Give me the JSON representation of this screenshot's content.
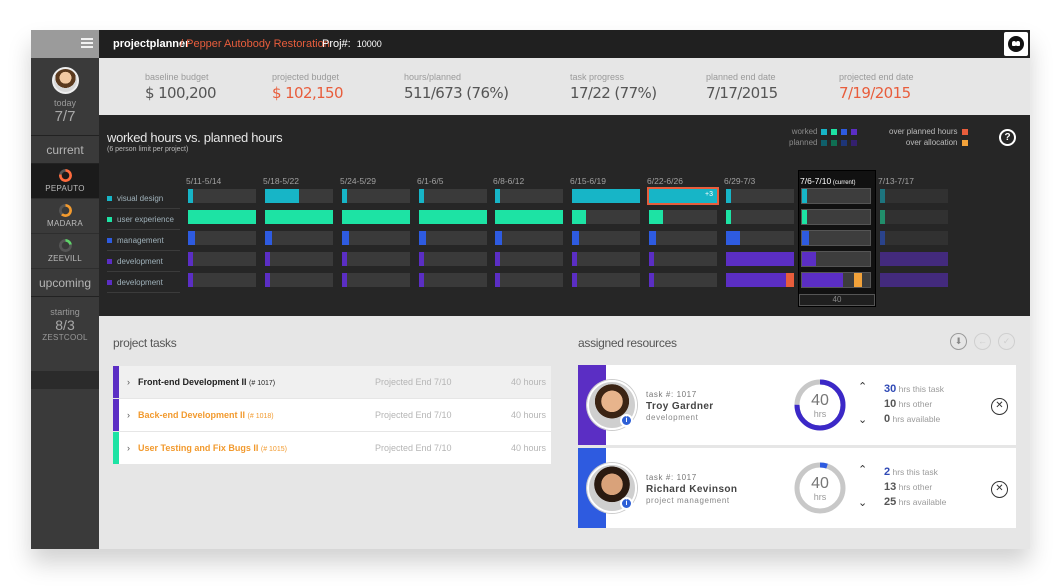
{
  "sidebar": {
    "today_label": "today",
    "today_date": "7/7",
    "current_label": "current",
    "projects": [
      {
        "name": "PEPAUTO",
        "ring_color": "#ff6b3d"
      },
      {
        "name": "MADARA",
        "ring_color": "#f29a2e"
      },
      {
        "name": "ZEEVILL",
        "ring_color": "#5fd36a"
      }
    ],
    "upcoming_label": "upcoming",
    "upcoming": {
      "starting_label": "starting",
      "date": "8/3",
      "name": "ZESTCOOL"
    }
  },
  "topbar": {
    "brand": "projectplanner",
    "breadcrumb": "/ Pepper Autobody Restoration",
    "proj_label": "Proj#:",
    "proj_number": "10000",
    "team_icon": "team-icon"
  },
  "stats": [
    {
      "label": "baseline budget",
      "value": "$ 100,200",
      "highlight": false
    },
    {
      "label": "projected budget",
      "value": "$ 102,150",
      "highlight": true
    },
    {
      "label": "hours/planned",
      "value": "511/673 (76%)",
      "highlight": false
    },
    {
      "label": "task progress",
      "value": "17/22 (77%)",
      "highlight": false
    },
    {
      "label": "planned end date",
      "value": "7/17/2015",
      "highlight": false
    },
    {
      "label": "projected end date",
      "value": "7/19/2015",
      "highlight": true
    }
  ],
  "chart_data": {
    "type": "table",
    "title": "worked hours vs. planned hours",
    "subtitle": "(6 person limit per project)",
    "legend": {
      "worked": "worked",
      "planned": "planned",
      "over_planned": "over planned hours",
      "over_allocation": "over allocation"
    },
    "colors": {
      "visual design": "#17b5c7",
      "user experience": "#1de3a4",
      "management": "#2e5be0",
      "development": "#5b2ec4",
      "over_planned": "#e85d3c",
      "over_allocation": "#f2a23a"
    },
    "rows": [
      "visual design",
      "user experience",
      "management",
      "development",
      "development"
    ],
    "weeks": [
      "5/11-5/14",
      "5/18-5/22",
      "5/24-5/29",
      "6/1-6/5",
      "6/8-6/12",
      "6/15-6/19",
      "6/22-6/26",
      "6/29-7/3",
      "7/6-7/10",
      "7/13-7/17"
    ],
    "current_week": "7/6-7/10",
    "current_tag": "(current)",
    "current_total": "40",
    "overflow_note": "+3",
    "worked_fraction": [
      [
        0.07,
        0.5,
        0.07,
        0.07,
        0.07,
        1.0,
        1.0,
        0.07,
        0.07,
        0.07
      ],
      [
        1.0,
        1.0,
        1.0,
        1.0,
        1.0,
        0.2,
        0.2,
        0.07,
        0.07,
        0.07
      ],
      [
        0.1,
        0.1,
        0.1,
        0.1,
        0.1,
        0.1,
        0.1,
        0.2,
        0.1,
        0.07
      ],
      [
        0.07,
        0.07,
        0.07,
        0.07,
        0.07,
        0.07,
        0.07,
        1.0,
        0.2,
        1.0
      ],
      [
        0.07,
        0.07,
        0.07,
        0.07,
        0.07,
        0.07,
        0.07,
        0.9,
        0.6,
        1.0
      ]
    ]
  },
  "tasks": {
    "title": "project tasks",
    "items": [
      {
        "name": "Front-end Development II",
        "id": "(# 1017)",
        "end": "Projected End 7/10",
        "hours": "40 hours",
        "color": "#5b2ec4",
        "active": true
      },
      {
        "name": "Back-end Development II",
        "id": "(# 1018)",
        "end": "Projected End 7/10",
        "hours": "40 hours",
        "color": "#5b2ec4",
        "active": false
      },
      {
        "name": "User Testing and Fix Bugs II",
        "id": "(# 1015)",
        "end": "Projected End 7/10",
        "hours": "40 hours",
        "color": "#1de3a4",
        "active": false
      }
    ]
  },
  "resources": {
    "title": "assigned resources",
    "controls": [
      "assign-icon",
      "back-icon",
      "check-icon"
    ],
    "people": [
      {
        "task": "task #: 1017",
        "name": "Troy Gardner",
        "role": "development",
        "hours": "40",
        "hrs_label": "hrs",
        "this_task": "30",
        "this_task_label": "hrs this task",
        "other": "10",
        "other_label": "hrs other",
        "available": "0",
        "available_label": "hrs available",
        "bar_color": "#5b2ec4",
        "gauge_fraction": 0.75
      },
      {
        "task": "task #: 1017",
        "name": "Richard Kevinson",
        "role": "project management",
        "hours": "40",
        "hrs_label": "hrs",
        "this_task": "2",
        "this_task_label": "hrs this task",
        "other": "13",
        "other_label": "hrs other",
        "available": "25",
        "available_label": "hrs available",
        "bar_color": "#2e5be0",
        "gauge_fraction": 0.05
      }
    ]
  }
}
